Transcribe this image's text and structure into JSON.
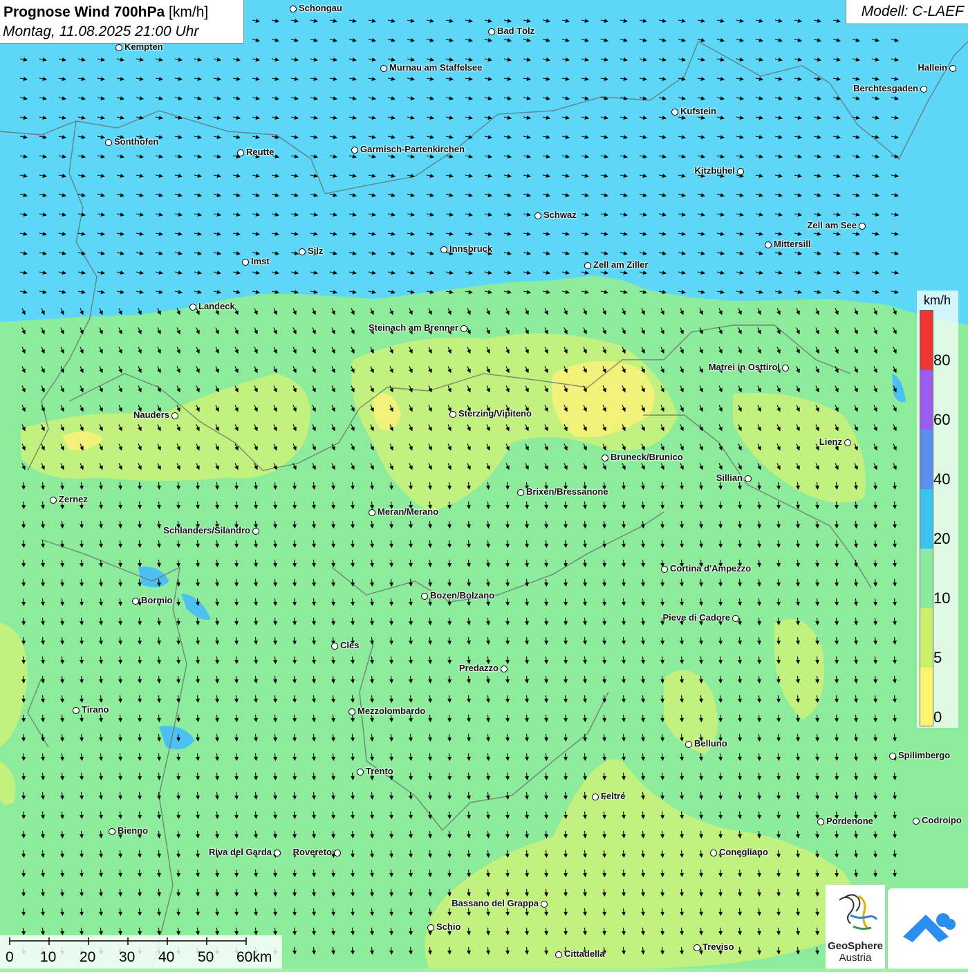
{
  "header": {
    "title_bold": "Prognose Wind 700hPa",
    "title_unit": "[km/h]",
    "datetime": "Montag, 11.08.2025 21:00 Uhr",
    "model": "Modell: C-LAEF"
  },
  "legend": {
    "unit": "km/h",
    "ticks": [
      "80",
      "60",
      "40",
      "20",
      "10",
      "5",
      "0"
    ],
    "colors": {
      "0-5": "#fff56a",
      "5-10": "#c8f069",
      "10-20": "#8aeb9c",
      "20-40": "#39c4f0",
      "40-60": "#5b8ef0",
      "60-80": "#9b5cf0",
      "80+": "#f03535"
    }
  },
  "scalebar": {
    "labels": [
      "0",
      "10",
      "20",
      "30",
      "40",
      "50",
      "60km"
    ]
  },
  "logos": {
    "geosphere_line1": "GeoSphere",
    "geosphere_line2": "Austria"
  },
  "cities": [
    {
      "name": "Schongau"
    },
    {
      "name": "Bad Tölz"
    },
    {
      "name": "Kempten"
    },
    {
      "name": "Murnau am Staffelsee"
    },
    {
      "name": "Hallein"
    },
    {
      "name": "Berchtesgaden"
    },
    {
      "name": "Kufstein"
    },
    {
      "name": "Sonthofen"
    },
    {
      "name": "Reutte"
    },
    {
      "name": "Garmisch-Partenkirchen"
    },
    {
      "name": "Kitzbühel"
    },
    {
      "name": "Schwaz"
    },
    {
      "name": "Zell am See"
    },
    {
      "name": "Mittersill"
    },
    {
      "name": "Innsbruck"
    },
    {
      "name": "Silz"
    },
    {
      "name": "Imst"
    },
    {
      "name": "Zell am Ziller"
    },
    {
      "name": "Landeck"
    },
    {
      "name": "Steinach am Brenner"
    },
    {
      "name": "Matrei in Osttirol"
    },
    {
      "name": "Nauders"
    },
    {
      "name": "Sterzing/Vipiteno"
    },
    {
      "name": "Lienz"
    },
    {
      "name": "Bruneck/Brunico"
    },
    {
      "name": "Sillian"
    },
    {
      "name": "Zernez"
    },
    {
      "name": "Brixen/Bressanone"
    },
    {
      "name": "Meran/Merano"
    },
    {
      "name": "Schlanders/Silandro"
    },
    {
      "name": "Cortina d'Ampezzo"
    },
    {
      "name": "Bozen/Bolzano"
    },
    {
      "name": "Bormio"
    },
    {
      "name": "Pieve di Cadore"
    },
    {
      "name": "Cles"
    },
    {
      "name": "Predazzo"
    },
    {
      "name": "Tirano"
    },
    {
      "name": "Mezzolombardo"
    },
    {
      "name": "Belluno"
    },
    {
      "name": "Spilimbergo"
    },
    {
      "name": "Trento"
    },
    {
      "name": "Feltre"
    },
    {
      "name": "Pordenone"
    },
    {
      "name": "Codroipo"
    },
    {
      "name": "Bienno"
    },
    {
      "name": "Riva del Garda"
    },
    {
      "name": "Rovereto"
    },
    {
      "name": "Conegliano"
    },
    {
      "name": "Bassano del Grappa"
    },
    {
      "name": "Schio"
    },
    {
      "name": "Treviso"
    },
    {
      "name": "Cittadella"
    }
  ]
}
